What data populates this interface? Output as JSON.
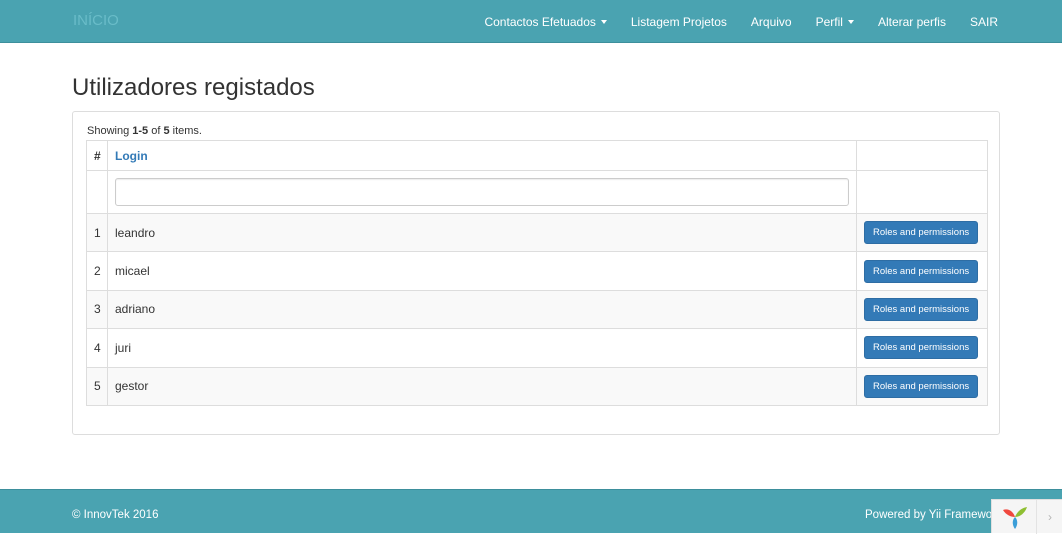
{
  "navbar": {
    "brand": "INÍCIO",
    "items": [
      {
        "label": "Contactos Efetuados",
        "dropdown": true
      },
      {
        "label": "Listagem Projetos",
        "dropdown": false
      },
      {
        "label": "Arquivo",
        "dropdown": false
      },
      {
        "label": "Perfil",
        "dropdown": true
      },
      {
        "label": "Alterar perfis",
        "dropdown": false
      },
      {
        "label": "SAIR",
        "dropdown": false
      }
    ]
  },
  "page": {
    "title": "Utilizadores registados"
  },
  "grid": {
    "summary_prefix": "Showing ",
    "summary_range": "1-5",
    "summary_of": " of ",
    "summary_total": "5",
    "summary_suffix": " items.",
    "columns": [
      "#",
      "Login",
      ""
    ],
    "filter_value": "",
    "rows": [
      {
        "index": "1",
        "login": "leandro",
        "action": "Roles and permissions"
      },
      {
        "index": "2",
        "login": "micael",
        "action": "Roles and permissions"
      },
      {
        "index": "3",
        "login": "adriano",
        "action": "Roles and permissions"
      },
      {
        "index": "4",
        "login": "juri",
        "action": "Roles and permissions"
      },
      {
        "index": "5",
        "login": "gestor",
        "action": "Roles and permissions"
      }
    ]
  },
  "footer": {
    "copyright": "© InnovTek 2016",
    "powered": "Powered by Yii Framework"
  },
  "debug_toolbar": {
    "logo_icon": "yii-logo-icon",
    "toggle_icon": "chevron-right-icon",
    "toggle_glyph": "›"
  },
  "colors": {
    "navbar": "#4aa3b1",
    "brand": "#69bcc8",
    "link": "#337ab7",
    "button": "#337ab7"
  }
}
